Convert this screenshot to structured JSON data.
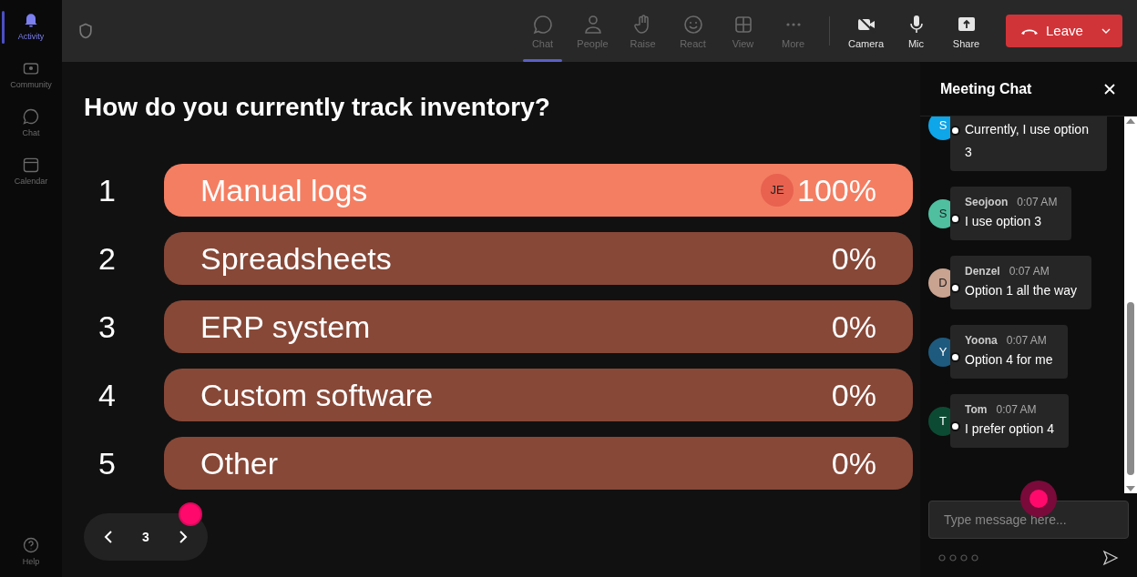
{
  "rail": {
    "items": [
      {
        "label": "Activity",
        "selected": true
      },
      {
        "label": "Community",
        "selected": false
      },
      {
        "label": "Chat",
        "selected": false
      },
      {
        "label": "Calendar",
        "selected": false
      }
    ],
    "help": {
      "label": "Help"
    }
  },
  "toolbar": {
    "items": [
      {
        "label": "Chat",
        "selected": true
      },
      {
        "label": "People",
        "selected": false
      },
      {
        "label": "Raise",
        "selected": false
      },
      {
        "label": "React",
        "selected": false
      },
      {
        "label": "View",
        "selected": false
      },
      {
        "label": "More",
        "selected": false
      }
    ],
    "devices": [
      {
        "label": "Camera"
      },
      {
        "label": "Mic"
      },
      {
        "label": "Share"
      }
    ],
    "leave": "Leave"
  },
  "poll": {
    "question": "How do you currently track inventory?",
    "options": [
      {
        "number": "1",
        "label": "Manual logs",
        "percent": "100%",
        "highlighted": true,
        "voter": "JE"
      },
      {
        "number": "2",
        "label": "Spreadsheets",
        "percent": "0%",
        "highlighted": false
      },
      {
        "number": "3",
        "label": "ERP system",
        "percent": "0%",
        "highlighted": false
      },
      {
        "number": "4",
        "label": "Custom software",
        "percent": "0%",
        "highlighted": false
      },
      {
        "number": "5",
        "label": "Other",
        "percent": "0%",
        "highlighted": false
      }
    ]
  },
  "pager": {
    "page": "3"
  },
  "chat": {
    "title": "Meeting Chat",
    "messages": [
      {
        "initial": "S",
        "color": "#0ea5e9",
        "text": "Currently, I use option 3"
      },
      {
        "initial": "S",
        "color": "#4fbfa0",
        "author": "Seojoon",
        "time": "0:07 AM",
        "text": "I use option 3"
      },
      {
        "initial": "D",
        "color": "#c9a290",
        "author": "Denzel",
        "time": "0:07 AM",
        "text": "Option 1 all the way"
      },
      {
        "initial": "Y",
        "color": "#1e5a7e",
        "author": "Yoona",
        "time": "0:07 AM",
        "text": "Option 4 for me"
      },
      {
        "initial": "T",
        "color": "#0d4a34",
        "author": "Tom",
        "time": "0:07 AM",
        "text": "I prefer option 4"
      }
    ],
    "placeholder": "Type message here..."
  }
}
